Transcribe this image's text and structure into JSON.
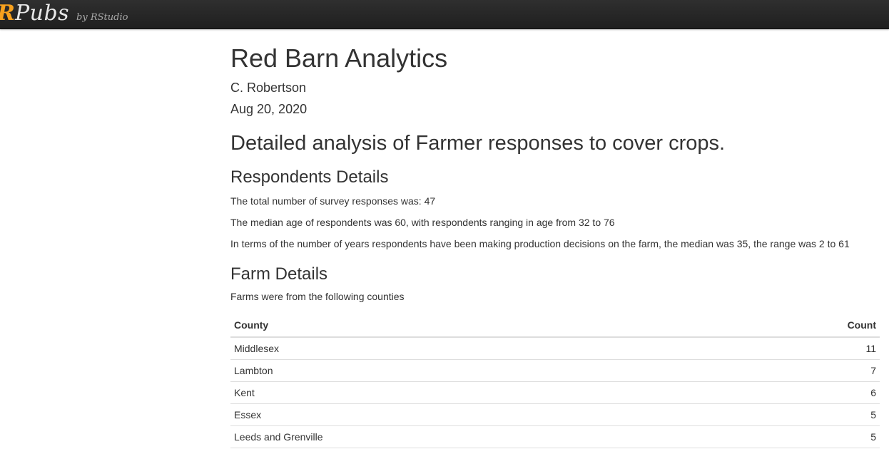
{
  "header": {
    "brand_r": "R",
    "brand_pubs": "Pubs",
    "brand_by": "by RStudio"
  },
  "doc": {
    "title": "Red Barn Analytics",
    "author": "C. Robertson",
    "date": "Aug 20, 2020",
    "section_title": "Detailed analysis of Farmer responses to cover crops.",
    "respondents": {
      "heading": "Respondents Details",
      "line1": "The total number of survey responses was: 47",
      "line2": "The median age of respondents was 60, with respondents ranging in age from 32 to 76",
      "line3": "In terms of the number of years respondents have been making production decisions on the farm, the median was 35, the range was 2 to 61"
    },
    "farm": {
      "heading": "Farm Details",
      "intro": "Farms were from the following counties",
      "columns": [
        "County",
        "Count"
      ],
      "rows": [
        [
          "Middlesex",
          "11"
        ],
        [
          "Lambton",
          "7"
        ],
        [
          "Kent",
          "6"
        ],
        [
          "Essex",
          "5"
        ],
        [
          "Leeds and Grenville",
          "5"
        ]
      ]
    }
  },
  "colors": {
    "topbar": "#262626",
    "brand_accent": "#f7a11d",
    "text": "#333333"
  }
}
